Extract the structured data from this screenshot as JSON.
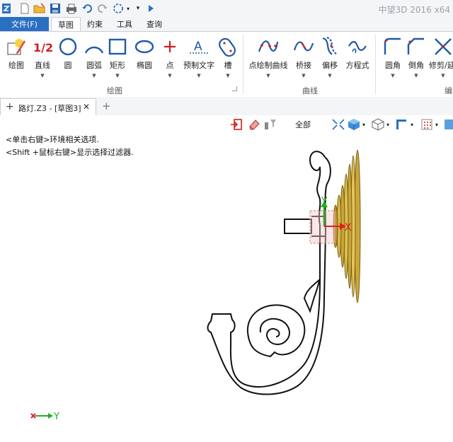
{
  "app": {
    "title": "中望3D 2016 x64"
  },
  "menu": {
    "file_label": "文件(F)",
    "tabs": [
      {
        "label": "草图",
        "active": true
      },
      {
        "label": "约束"
      },
      {
        "label": "工具"
      },
      {
        "label": "查询"
      }
    ]
  },
  "ribbon": {
    "groups": {
      "draw": "绘图",
      "curve": "曲线",
      "edit": "编"
    },
    "tools": {
      "draw": "绘图",
      "line": "直线",
      "circle": "圆",
      "arc": "圆弧",
      "rect": "矩形",
      "ellipse": "椭圆",
      "point": "点",
      "pretext": "预制文字",
      "slot": "槽",
      "pointcurve": "点绘制曲线",
      "bridge": "桥接",
      "offset": "偏移",
      "equation": "方程式",
      "fillet": "圆角",
      "chamfer": "倒角",
      "trim": "修剪/延"
    },
    "line_icon_text": "1/2",
    "pretext_icon_text": "A"
  },
  "doc_tab": {
    "title": "路灯.Z3 - [草图3]"
  },
  "viewbar": {
    "filter": "全部"
  },
  "canvas": {
    "hint1": "<单击右键>环境相关选项.",
    "hint2": "<Shift +鼠标右键>显示选择过滤器."
  },
  "axis": {
    "x": "X",
    "y": "Y",
    "triad_y": "Y"
  },
  "colors": {
    "accent": "#2b6fc2",
    "sketch": "#111111",
    "lamp": "#b89a2c",
    "axis_x": "#e02020",
    "axis_y": "#20b020"
  }
}
